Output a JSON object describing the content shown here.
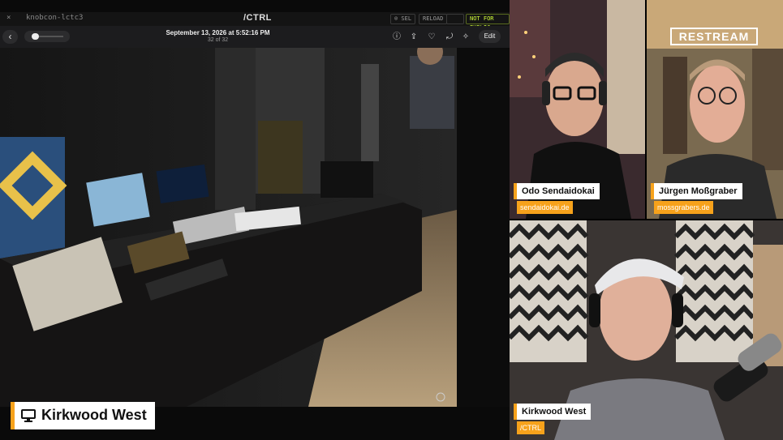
{
  "terminal": {
    "tab": "knobcon-lctc3",
    "brand": "/CTRL",
    "pill_sel": "⌾ SEL",
    "pill_reload": "RELOAD",
    "pill_public": "NOT FOR PUBLIC",
    "close": "×"
  },
  "photo_viewer": {
    "title": "September 13, 2026 at 5:52:16 PM",
    "counter": "32 of 32",
    "edit_label": "Edit",
    "back": "‹"
  },
  "main_lower_third": {
    "name": "Kirkwood West"
  },
  "overlay_brand": "RESTREAM",
  "participants": [
    {
      "name": "Odo Sendaidokai",
      "subtitle": "sendaidokai.de"
    },
    {
      "name": "Jürgen Moßgraber",
      "subtitle": "mossgrabers.de"
    },
    {
      "name": "Kirkwood West",
      "subtitle": "/CTRL"
    }
  ],
  "colors": {
    "accent": "#f7a21b",
    "terminal_accent": "#d4ff3a"
  }
}
